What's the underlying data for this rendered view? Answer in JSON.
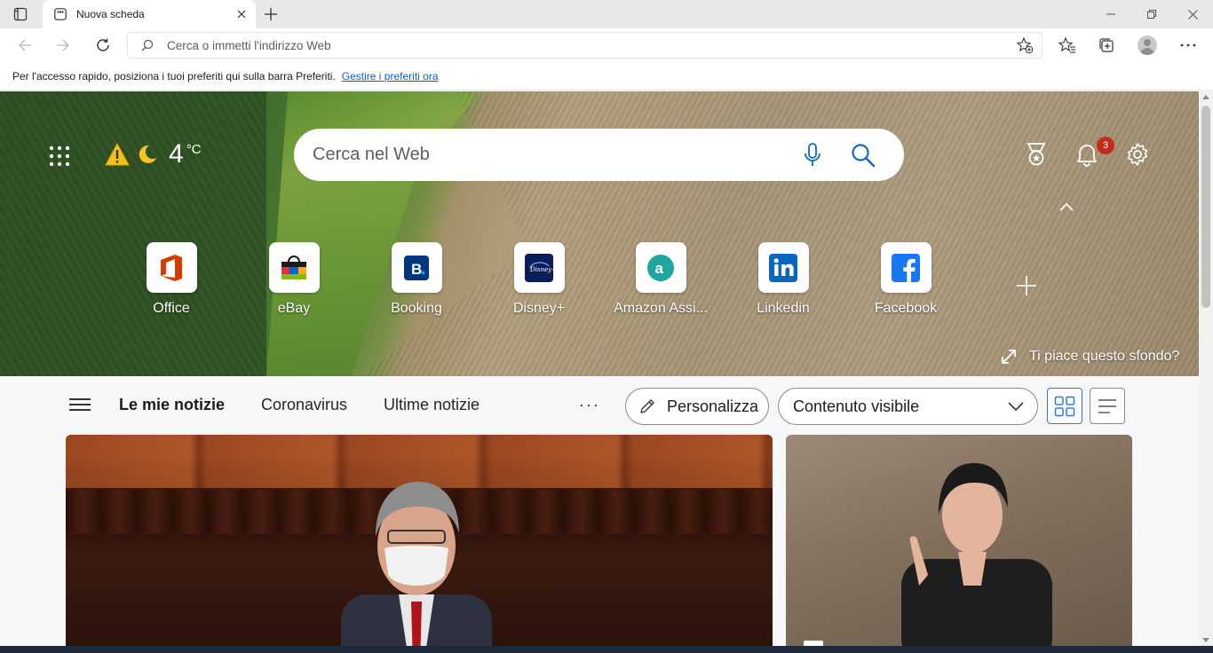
{
  "tab": {
    "title": "Nuova scheda"
  },
  "address": {
    "placeholder": "Cerca o immetti l'indirizzo Web"
  },
  "favbar": {
    "text": "Per l'accesso rapido, posiziona i tuoi preferiti qui sulla barra Preferiti.",
    "link": "Gestire i preferiti ora"
  },
  "weather": {
    "temp": "4",
    "unit": "°C"
  },
  "websearch": {
    "placeholder": "Cerca nel Web"
  },
  "notifications": {
    "count": "3"
  },
  "quicklinks": [
    {
      "label": "Office",
      "icon": "office-icon"
    },
    {
      "label": "eBay",
      "icon": "ebay-icon"
    },
    {
      "label": "Booking",
      "icon": "booking-icon"
    },
    {
      "label": "Disney+",
      "icon": "disney-icon"
    },
    {
      "label": "Amazon Assi...",
      "icon": "amazon-icon"
    },
    {
      "label": "Linkedin",
      "icon": "linkedin-icon"
    },
    {
      "label": "Facebook",
      "icon": "facebook-icon"
    }
  ],
  "background": {
    "like_text": "Ti piace questo sfondo?"
  },
  "news": {
    "tabs": [
      "Le mie notizie",
      "Coronavirus",
      "Ultime notizie"
    ],
    "more": "···",
    "personalize": "Personalizza",
    "visibility": "Contenuto visibile"
  }
}
